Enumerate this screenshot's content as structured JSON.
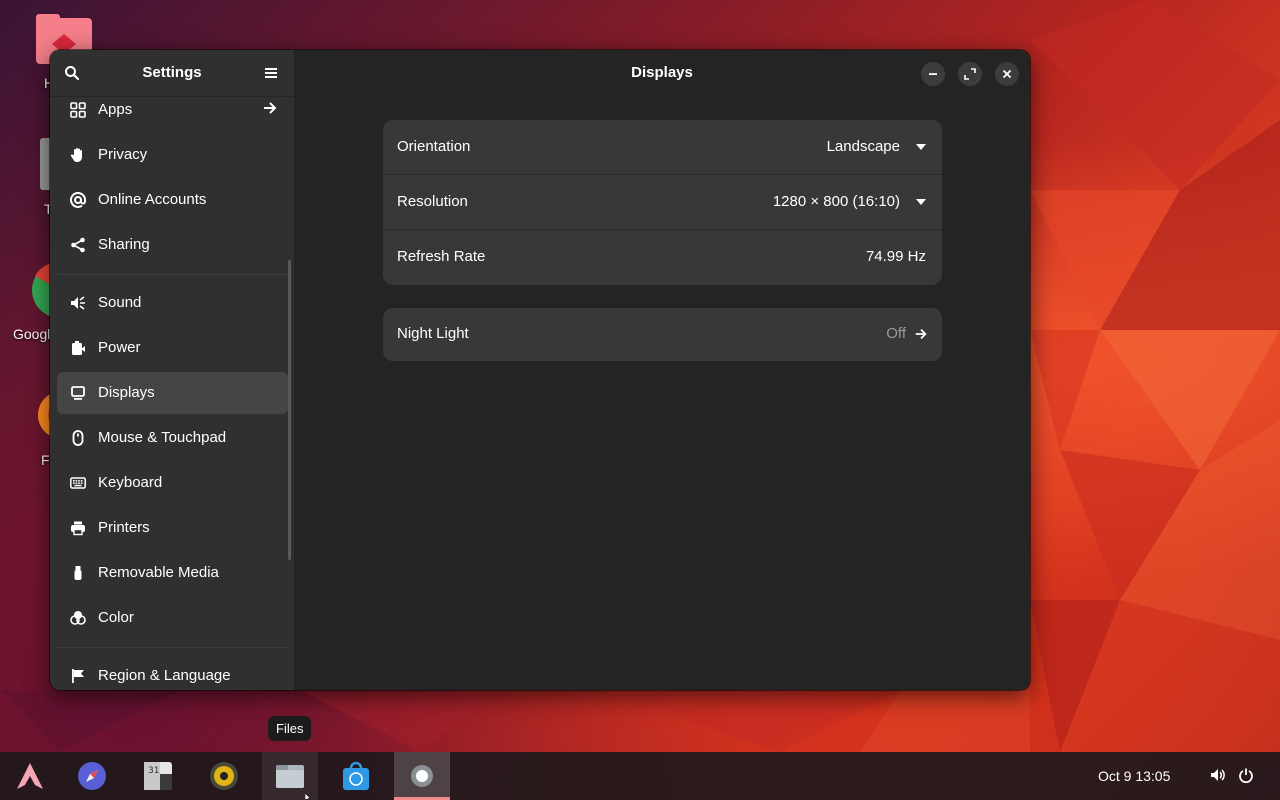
{
  "window": {
    "sidebar_title": "Settings",
    "main_title": "Displays"
  },
  "sidebar": {
    "items": [
      {
        "label": "Apps",
        "icon": "apps-grid-icon",
        "has_arrow": true
      },
      {
        "label": "Privacy",
        "icon": "hand-icon"
      },
      {
        "label": "Online Accounts",
        "icon": "at-sign-icon"
      },
      {
        "label": "Sharing",
        "icon": "share-icon"
      },
      {
        "label": "Sound",
        "icon": "speaker-icon"
      },
      {
        "label": "Power",
        "icon": "battery-icon"
      },
      {
        "label": "Displays",
        "icon": "monitor-icon",
        "active": true
      },
      {
        "label": "Mouse & Touchpad",
        "icon": "mouse-icon"
      },
      {
        "label": "Keyboard",
        "icon": "keyboard-icon"
      },
      {
        "label": "Printers",
        "icon": "printer-icon"
      },
      {
        "label": "Removable Media",
        "icon": "usb-icon"
      },
      {
        "label": "Color",
        "icon": "color-circles-icon"
      },
      {
        "label": "Region & Language",
        "icon": "flag-icon"
      }
    ]
  },
  "display_settings": {
    "orientation": {
      "label": "Orientation",
      "value": "Landscape"
    },
    "resolution": {
      "label": "Resolution",
      "value": "1280 × 800 (16:10)"
    },
    "refresh_rate": {
      "label": "Refresh Rate",
      "value": "74.99 Hz"
    },
    "night_light": {
      "label": "Night Light",
      "value": "Off"
    }
  },
  "desktop": {
    "icons": [
      {
        "label": "H",
        "icon": "home-folder-icon"
      },
      {
        "label": "T",
        "icon": "trash-icon"
      },
      {
        "label": "Googl",
        "icon": "chrome-icon"
      },
      {
        "label": "F",
        "icon": "firefox-icon"
      }
    ]
  },
  "taskbar": {
    "apps": [
      "arch-launcher-icon",
      "browser-compass-icon",
      "calendar-icon",
      "music-player-icon",
      "files-icon",
      "software-store-icon",
      "settings-icon"
    ],
    "tooltip": "Files",
    "clock": "Oct 9  13:05"
  },
  "colors": {
    "window_bg": "#242424",
    "sidebar_bg": "#303030",
    "card_bg": "#383838",
    "active_indicator": "#f28a8a"
  }
}
